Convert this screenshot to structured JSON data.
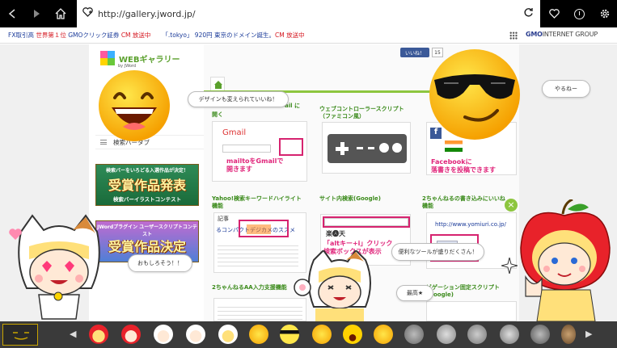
{
  "browser": {
    "url": "http://gallery.jword.jp/",
    "icons": [
      "back-icon",
      "forward-icon",
      "home-icon",
      "favorite-icon",
      "refresh-icon",
      "heart-icon",
      "history-icon",
      "settings-icon"
    ]
  },
  "ads": [
    {
      "link": "FX取引高 ",
      "highlight": "世界第１位",
      "rest": " GMOクリック証券 ",
      "cm": "CM 放送中"
    },
    {
      "link": "「.tokyo」 920円 ",
      "highlight": "",
      "rest": "東京のドメイン誕生。",
      "cm": "CM 放送中"
    }
  ],
  "gmo": {
    "logo_bold": "GMO",
    "logo_lite": "INTERNET GROUP"
  },
  "site": {
    "brand": "WEBギャラリー",
    "brand_by": "by",
    "brand_sub": "JWord",
    "fb_like": "いいね！",
    "fb_count": "15",
    "search_tab": "検索バータブ",
    "banner1": {
      "sub": "検索バーをいろどる入選作品が決定！",
      "big": "受賞作品発表",
      "foot": "検索バーイラストコンテスト"
    },
    "banner2": {
      "sub": "JWordプラグイン ユーザースクリプトコンテスト",
      "big": "受賞作品決定",
      "foot": ""
    },
    "partial_left": "ail に",
    "partial_left2": "開く",
    "cards": [
      {
        "title": "",
        "caption": "mailtoをGmailで\n開きます",
        "thumb_label": "Gmail"
      },
      {
        "title": "ウェブコントローラースクリプト\n（ファミコン風）",
        "caption": ""
      },
      {
        "title": "",
        "caption": "Facebookに\n落書きを投稿できます",
        "thumb_label": "f"
      },
      {
        "title": "Yahoo!検索キーワードハイライト\n機能",
        "caption": ""
      },
      {
        "title": "サイト内検索(Google)",
        "caption": "「altキー+i」クリック\n検索ボックスが表示"
      },
      {
        "title": "2ちゃんねるの書き込みにいいね\n機能",
        "caption": ""
      },
      {
        "title": "2ちゃんねるAA入力支援機能",
        "caption": ""
      },
      {
        "title": "ビゲーション固定スクリプト\n(Google)",
        "caption": ""
      }
    ],
    "yahoo_thumb": {
      "line1": "記事",
      "line2": "るコンパクトデジカメのススメ"
    },
    "site_thumb": {
      "line1": "楽🅐天"
    },
    "ch_thumb": {
      "line1": "http://www.yomiuri.co.jp/"
    }
  },
  "bubbles": [
    "デザインも変えられていいね！",
    "やるねー",
    "おもしろそう！！",
    "便利なツールが盛りだくさん！",
    "最高★"
  ],
  "colors": {
    "accent_green": "#8dc63f",
    "caption_pink": "#e0247a",
    "ad_blue": "#1a3a99",
    "ad_red": "#d4131c"
  }
}
